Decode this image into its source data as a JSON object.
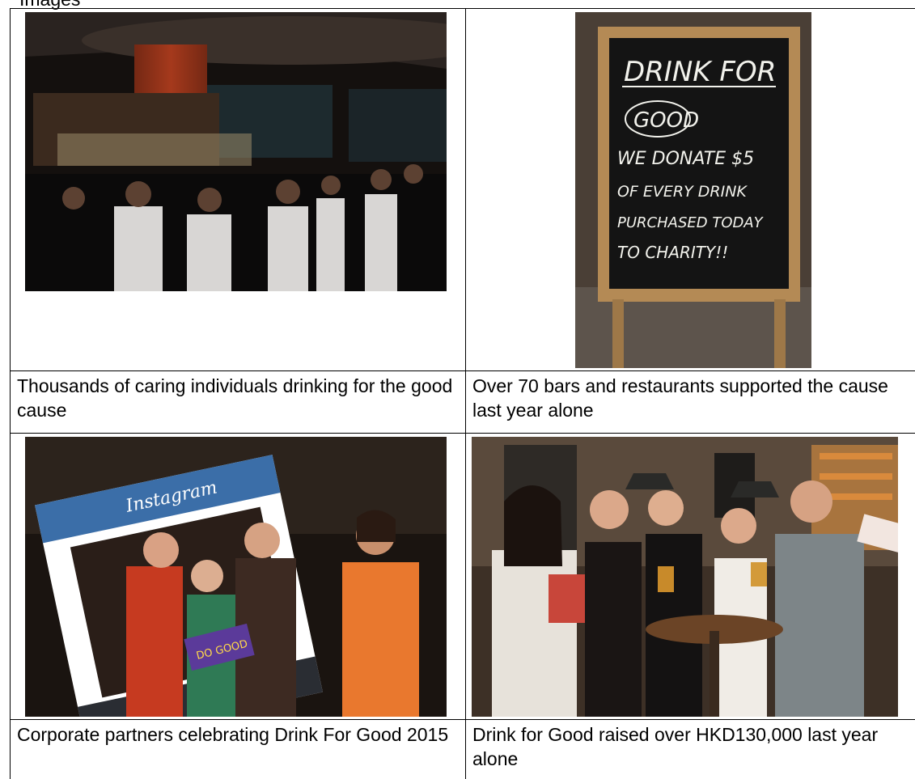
{
  "heading": "Images",
  "cells": [
    {
      "caption": "Thousands of caring individuals drinking for the good cause",
      "photo": "bar-crowd-photo"
    },
    {
      "caption": "Over 70 bars and restaurants supported the cause last year alone",
      "photo": "chalkboard-sign-photo",
      "sign_lines": [
        "DRINK FOR",
        "GOOD",
        "WE DONATE $5",
        "OF EVERY DRINK",
        "PURCHASED TODAY",
        "TO CHARITY!!"
      ]
    },
    {
      "caption": "Corporate partners celebrating Drink For Good 2015",
      "photo": "instagram-frame-photo",
      "frame_label": "Instagram",
      "placard_text": "DO GOOD"
    },
    {
      "caption": "Drink for Good raised over HKD130,000 last year alone",
      "photo": "group-cheers-photo"
    }
  ]
}
